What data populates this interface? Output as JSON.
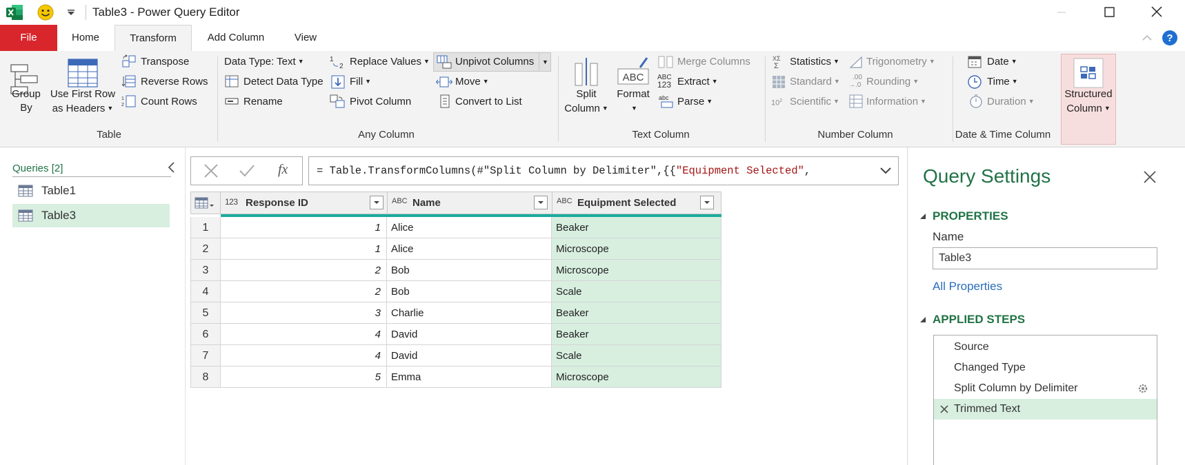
{
  "window": {
    "title": "Table3 - Power Query Editor"
  },
  "ribbon_tabs": [
    "File",
    "Home",
    "Transform",
    "Add Column",
    "View"
  ],
  "ribbon": {
    "table_group": {
      "label": "Table",
      "group_by": [
        "Group",
        "By"
      ],
      "use_first_row": [
        "Use First Row",
        "as Headers"
      ],
      "transpose": "Transpose",
      "reverse_rows": "Reverse Rows",
      "count_rows": "Count Rows"
    },
    "any_column_group": {
      "label": "Any Column",
      "data_type": "Data Type: Text",
      "detect_data_type": "Detect Data Type",
      "rename": "Rename",
      "replace_values": "Replace Values",
      "fill": "Fill",
      "pivot_column": "Pivot Column",
      "unpivot_columns": "Unpivot Columns",
      "move": "Move",
      "convert_to_list": "Convert to List"
    },
    "text_column_group": {
      "label": "Text Column",
      "split_column": [
        "Split",
        "Column"
      ],
      "format": "Format",
      "merge_columns": "Merge Columns",
      "extract": "Extract",
      "parse": "Parse",
      "abc_icon": "ABC",
      "abc123_icon": [
        "ABC",
        "123"
      ],
      "abc_small_icon": "abc"
    },
    "number_column_group": {
      "label": "Number Column",
      "statistics": "Statistics",
      "standard": "Standard",
      "scientific": "Scientific",
      "trigonometry": "Trigonometry",
      "rounding": "Rounding",
      "information": "Information"
    },
    "datetime_group": {
      "label": "Date & Time Column",
      "date": "Date",
      "time": "Time",
      "duration": "Duration"
    },
    "structured_column": [
      "Structured",
      "Column"
    ]
  },
  "queries": {
    "header": "Queries [2]",
    "items": [
      "Table1",
      "Table3"
    ],
    "selected": "Table3"
  },
  "formula_bar": {
    "prefix": "= Table.TransformColumns(#\"Split Column by Delimiter\",{{",
    "string_part": "\"Equipment Selected\"",
    "suffix": ",",
    "fx": "fx"
  },
  "table": {
    "columns": [
      {
        "type_icon": "123",
        "name": "Response ID"
      },
      {
        "type_icon": "ABC",
        "name": "Name"
      },
      {
        "type_icon": "ABC",
        "name": "Equipment Selected"
      }
    ],
    "rows": [
      {
        "n": "1",
        "id": "1",
        "name": "Alice",
        "equipment": "Beaker"
      },
      {
        "n": "2",
        "id": "1",
        "name": "Alice",
        "equipment": "Microscope"
      },
      {
        "n": "3",
        "id": "2",
        "name": "Bob",
        "equipment": "Microscope"
      },
      {
        "n": "4",
        "id": "2",
        "name": "Bob",
        "equipment": "Scale"
      },
      {
        "n": "5",
        "id": "3",
        "name": "Charlie",
        "equipment": "Beaker"
      },
      {
        "n": "6",
        "id": "4",
        "name": "David",
        "equipment": "Beaker"
      },
      {
        "n": "7",
        "id": "4",
        "name": "David",
        "equipment": "Scale"
      },
      {
        "n": "8",
        "id": "5",
        "name": "Emma",
        "equipment": "Microscope"
      }
    ]
  },
  "query_settings": {
    "title": "Query Settings",
    "properties_header": "PROPERTIES",
    "name_label": "Name",
    "name_value": "Table3",
    "all_properties": "All Properties",
    "applied_steps_header": "APPLIED STEPS",
    "steps": [
      "Source",
      "Changed Type",
      "Split Column by Delimiter",
      "Trimmed Text"
    ],
    "selected_step": "Trimmed Text"
  },
  "colors": {
    "file_tab": "#d8262c",
    "accent_green": "#217346",
    "selection_green": "#d8efe0",
    "teal_bar": "#1bab9e",
    "link_blue": "#2a6ebb",
    "formula_string": "#a31515",
    "help_blue": "#1f6fd1"
  }
}
